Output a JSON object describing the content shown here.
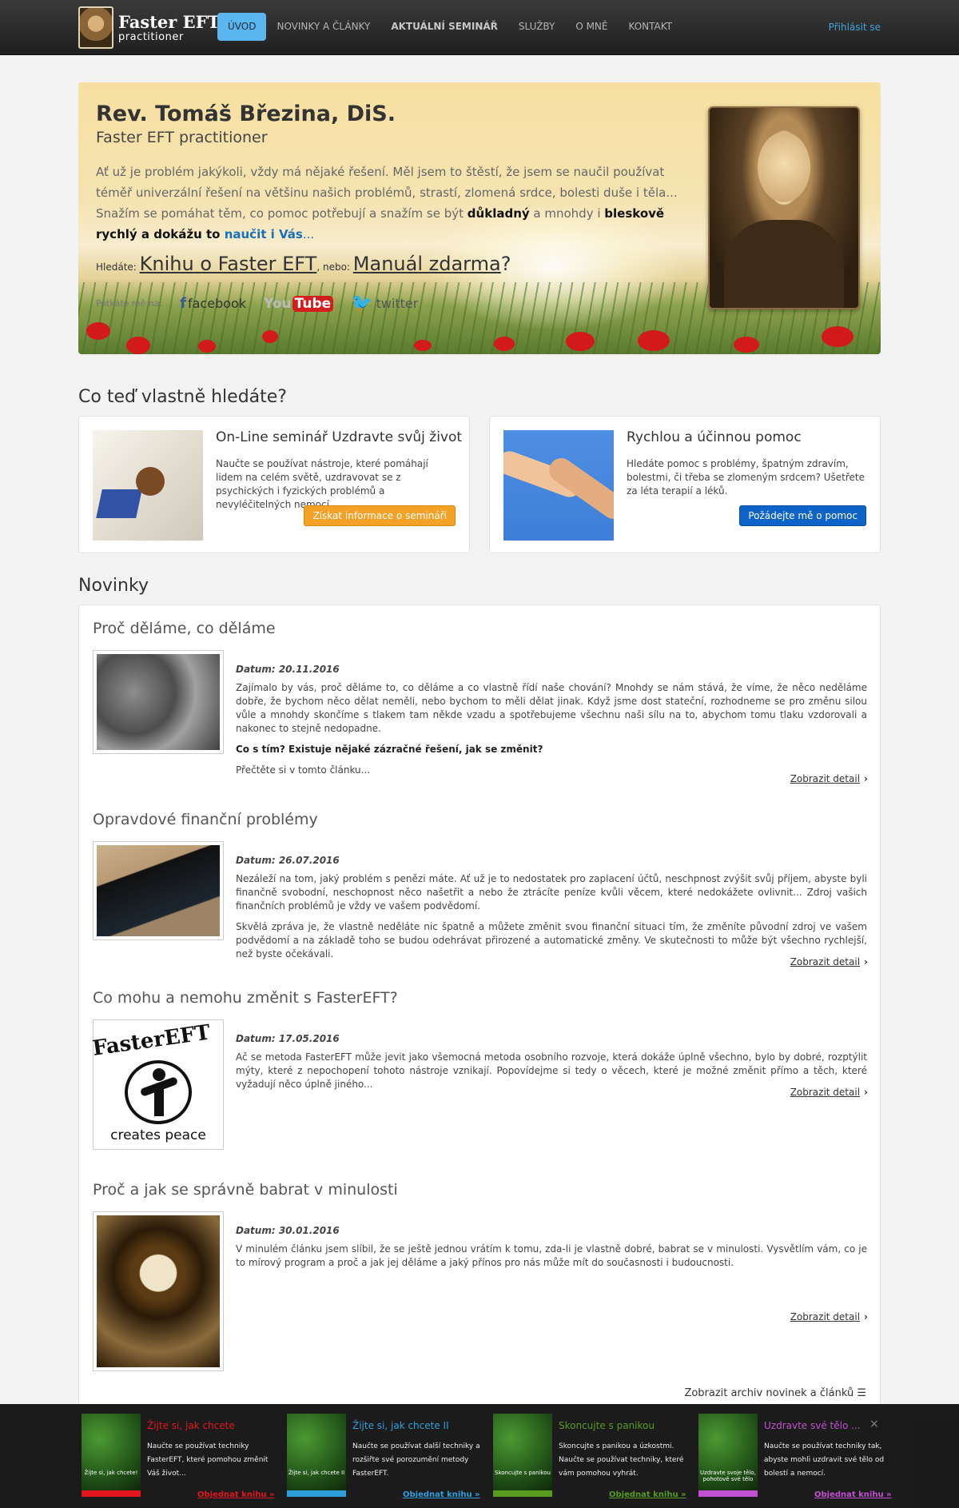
{
  "header": {
    "brand_title": "Faster EFT",
    "brand_sub": "practitioner",
    "nav": [
      {
        "label": "ÚVOD",
        "active": true
      },
      {
        "label": "NOVINKY A ČLÁNKY"
      },
      {
        "label": "AKTUÁLNÍ SEMINÁŘ",
        "bold": true
      },
      {
        "label": "SLUŽBY"
      },
      {
        "label": "O MNĚ"
      },
      {
        "label": "KONTAKT"
      }
    ],
    "login": "Přihlásit se"
  },
  "hero": {
    "name": "Rev. Tomáš Březina, DiS.",
    "subtitle": "Faster EFT practitioner",
    "intro_1": "Ať už je problém jakýkoli, vždy má nějaké řešení. Měl jsem to štěstí, že jsem se naučil používat téměř univerzální řešení na většinu našich problémů, strastí, zlomená srdce, bolesti duše i těla... Snažím se pomáhat těm, co pomoc potřebují a snažím se být ",
    "intro_b1": "důkladný",
    "intro_2": " a mnohdy i ",
    "intro_b2": "bleskově rychlý a dokážu to ",
    "intro_blue": "naučit i Vás",
    "intro_end": "...",
    "seeking_label": "Hledáte:",
    "seeking_link1": "Knihu o Faster EFT",
    "seeking_or": ", nebo:",
    "seeking_link2": "Manuál zdarma",
    "seeking_q": "?",
    "meet_label": "Potkáte mě na:",
    "facebook": "facebook",
    "youtube_you": "You",
    "youtube_tube": "Tube",
    "twitter": "twitter"
  },
  "looking": {
    "title": "Co teď vlastně hledáte?",
    "cards": [
      {
        "title": "On-Line seminář Uzdravte svůj život",
        "text": "Naučte se používat nástroje, které pomáhají lidem na celém světě, uzdravovat se z psychických i fyzických problémů a nevyléčitelných nemocí.",
        "button": "Získat informace o semináři"
      },
      {
        "title": "Rychlou a účinnou pomoc",
        "text": "Hledáte pomoc s problémy, špatným zdravím, bolestmi, či třeba se zlomeným srdcem? Ušetřete za léta terapií a léků.",
        "button": "Požádejte mě o pomoc"
      }
    ]
  },
  "news": {
    "title": "Novinky",
    "detail_label": "Zobrazit detail",
    "archive_label": "Zobrazit archiv novinek a článků",
    "articles": [
      {
        "title": "Proč děláme, co děláme",
        "date_label": "Datum:",
        "date": "20.11.2016",
        "p1": "Zajímalo by vás, proč děláme to, co děláme a co vlastně řídí naše chování? Mnohdy se nám stává, že víme, že něco neděláme dobře, že bychom něco dělat neměli, nebo bychom to měli dělat jinak. Když jsme dost stateční, rozhodneme se pro změnu silou vůle a mnohdy skončíme s tlakem tam někde vzadu a spotřebujeme všechnu naši sílu na to, abychom tomu tlaku vzdorovali a nakonec to stejně nedopadne.",
        "p2": "Co s tím? Existuje nějaké zázračné řešení, jak se změnit?",
        "p3": "Přečtěte si v tomto článku..."
      },
      {
        "title": "Opravdové finanční problémy",
        "date_label": "Datum:",
        "date": "26.07.2016",
        "p1": "Nezáleží na tom, jaký problém s penězi máte. Ať už je to nedostatek pro zaplacení účtů, neschpnost zvýšit svůj příjem, abyste byli finančně svobodní, neschopnost něco našetřit a nebo že ztrácíte peníze kvůli věcem, které nedokážete ovlivnit... Zdroj vašich finančních problémů je vždy ve vašem podvědomí.",
        "p2": "Skvělá zpráva je, že vlastně neděláte nic špatně a můžete změnit svou finanční situaci tím, že změníte původní zdroj ve vašem podvědomí a na základě toho se budou odehrávat přirozené a automatické změny. Ve skutečnosti to může být všechno rychlejší, než byste očekávali."
      },
      {
        "title": "Co mohu a nemohu změnit s FasterEFT?",
        "date_label": "Datum:",
        "date": "17.05.2016",
        "p1": "Ač se metoda FasterEFT může jevit jako všemocná metoda osobního rozvoje, která dokáže úplně všechno, bylo by dobré, rozptýlit mýty, které z nepochopení tohoto nástroje vznikají. Popovídejme si tedy o věcech, které je možné změnit přímo a těch, které vyžadují něco úplně jiného...",
        "logo_top": "FasterEFT",
        "logo_bottom": "creates peace"
      },
      {
        "title": "Proč a jak se správně babrat v minulosti",
        "date_label": "Datum:",
        "date": "30.01.2016",
        "p1": "V minulém článku jsem slíbil, že se ještě jednou vrátím k tomu, zda-li je vlastně dobré, babrat se v minulosti. Vysvětlím vám, co je to mírový program a proč a jak jej děláme a jaký přínos pro nás může mít do současnosti i budoucnosti."
      }
    ]
  },
  "books": [
    {
      "title": "Žijte si, jak chcete",
      "text": "Naučte se používat techniky FasterEFT, které pomohou změnit Váš život...",
      "cover": "Žijte si, jak chcete!",
      "order": "Objednat knihu »",
      "color": "#e3151f"
    },
    {
      "title": "Žijte si, jak chcete II",
      "text": "Naučte se používat další techniky a rozšiřte své porozumění metody FasterEFT.",
      "cover": "Žijte si, jak chcete II",
      "order": "Objednat knihu »",
      "color": "#2f9fdc"
    },
    {
      "title": "Skoncujte s panikou",
      "text": "Skoncujte s panikou a úzkostmi. Naučte se používat techniky, které vám pomohou vyhrát.",
      "cover": "Skoncujte s panikou",
      "order": "Objednat knihu »",
      "color": "#5a9a1f"
    },
    {
      "title": "Uzdravte své tělo ...",
      "text": "Naučte se používat techniky tak, abyste mohli uzdravit své tělo od bolestí a nemocí.",
      "cover": "Uzdravte svoje tělo, pohotově své tělo",
      "order": "Objednat knihu »",
      "color": "#c251d1"
    }
  ],
  "close_label": "×"
}
